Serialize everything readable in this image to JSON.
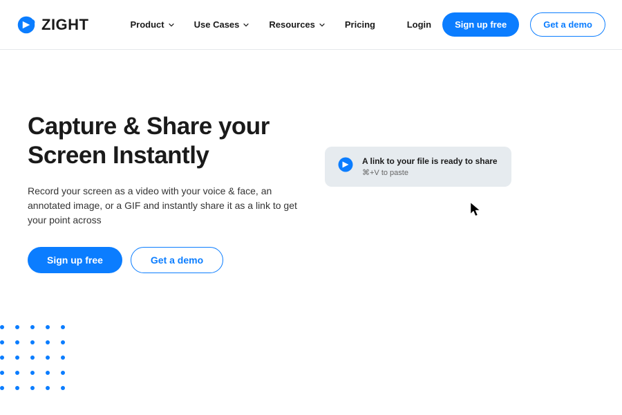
{
  "brand": {
    "name": "ZIGHT"
  },
  "nav": {
    "items": [
      {
        "label": "Product",
        "has_dropdown": true
      },
      {
        "label": "Use Cases",
        "has_dropdown": true
      },
      {
        "label": "Resources",
        "has_dropdown": true
      },
      {
        "label": "Pricing",
        "has_dropdown": false
      }
    ]
  },
  "header_actions": {
    "login": "Login",
    "signup": "Sign up free",
    "demo": "Get a demo"
  },
  "hero": {
    "title": "Capture & Share your Screen Instantly",
    "description": "Record your screen as a video with your voice & face, an annotated image, or a GIF and instantly share it as a link to get your point across",
    "cta_primary": "Sign up free",
    "cta_secondary": "Get a demo"
  },
  "notification": {
    "title": "A link to your file is ready to share",
    "subtitle": "⌘+V to paste"
  },
  "colors": {
    "primary": "#0b7dff",
    "text": "#1a1a1a"
  }
}
